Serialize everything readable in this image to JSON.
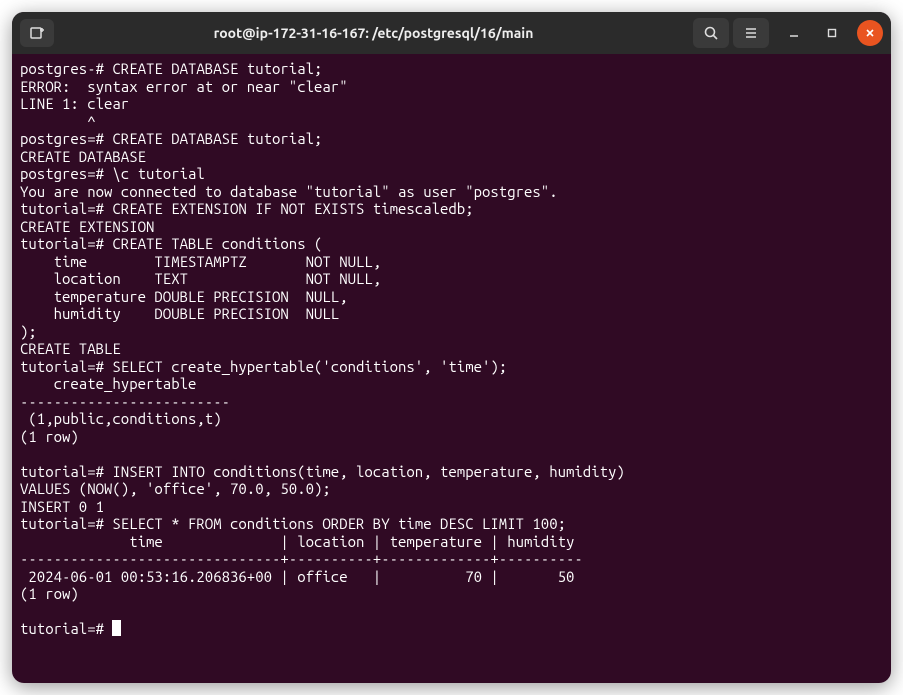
{
  "titlebar": {
    "title": "root@ip-172-31-16-167: /etc/postgresql/16/main"
  },
  "terminal": {
    "lines": [
      "postgres-# CREATE DATABASE tutorial;",
      "ERROR:  syntax error at or near \"clear\"",
      "LINE 1: clear",
      "        ^",
      "postgres=# CREATE DATABASE tutorial;",
      "CREATE DATABASE",
      "postgres=# \\c tutorial",
      "You are now connected to database \"tutorial\" as user \"postgres\".",
      "tutorial=# CREATE EXTENSION IF NOT EXISTS timescaledb;",
      "CREATE EXTENSION",
      "tutorial=# CREATE TABLE conditions (",
      "    time        TIMESTAMPTZ       NOT NULL,",
      "    location    TEXT              NOT NULL,",
      "    temperature DOUBLE PRECISION  NULL,",
      "    humidity    DOUBLE PRECISION  NULL",
      ");",
      "CREATE TABLE",
      "tutorial=# SELECT create_hypertable('conditions', 'time');",
      "    create_hypertable    ",
      "-------------------------",
      " (1,public,conditions,t)",
      "(1 row)",
      "",
      "tutorial=# INSERT INTO conditions(time, location, temperature, humidity)",
      "VALUES (NOW(), 'office', 70.0, 50.0);",
      "INSERT 0 1",
      "tutorial=# SELECT * FROM conditions ORDER BY time DESC LIMIT 100;",
      "             time              | location | temperature | humidity ",
      "-------------------------------+----------+-------------+----------",
      " 2024-06-01 00:53:16.206836+00 | office   |          70 |       50",
      "(1 row)",
      "",
      "tutorial=# "
    ]
  }
}
